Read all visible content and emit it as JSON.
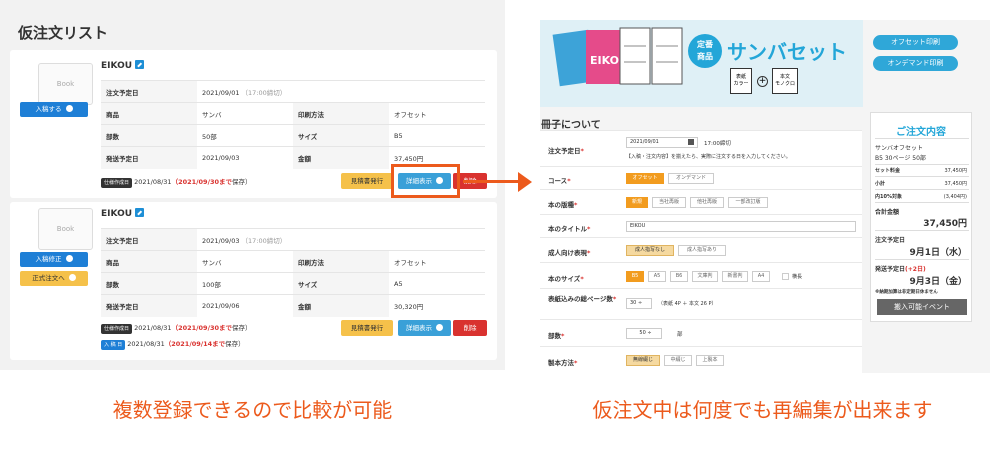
{
  "left": {
    "title": "仮注文リスト",
    "book_placeholder": "Book",
    "cards": [
      {
        "company": "EIKOU",
        "button1": "入稿する",
        "button2": "",
        "rows": [
          [
            "注文予定日",
            "2021/09/01",
            "（17:00締切）",
            "",
            ""
          ],
          [
            "商品",
            "サンバ",
            "",
            "印刷方法",
            "オフセット"
          ],
          [
            "部数",
            "50部",
            "",
            "サイズ",
            "B5"
          ],
          [
            "発送予定日",
            "2021/09/03",
            "",
            "金額",
            "37,450円"
          ]
        ],
        "status_badge": "仕様作成日",
        "status_date": "2021/08/31",
        "status_red": "（2021/09/30まで",
        "status_tail": "保存）",
        "status2_badge": "",
        "status2_date": "",
        "status2_red": "",
        "status2_tail": "",
        "btn_estimate": "見積書発行",
        "btn_detail": "詳細表示",
        "btn_delete": "削除"
      },
      {
        "company": "EIKOU",
        "button1": "入稿修正",
        "button2": "正式注文へ",
        "rows": [
          [
            "注文予定日",
            "2021/09/03",
            "（17:00締切）",
            "",
            ""
          ],
          [
            "商品",
            "サンバ",
            "",
            "印刷方法",
            "オフセット"
          ],
          [
            "部数",
            "100部",
            "",
            "サイズ",
            "A5"
          ],
          [
            "発送予定日",
            "2021/09/06",
            "",
            "金額",
            "30,320円"
          ]
        ],
        "status_badge": "仕様作成日",
        "status_date": "2021/08/31",
        "status_red": "（2021/09/30まで",
        "status_tail": "保存）",
        "status2_badge": "入 稿 日",
        "status2_date": "2021/08/31",
        "status2_red": "（2021/09/14まで",
        "status2_tail": "保存）",
        "btn_estimate": "見積書発行",
        "btn_detail": "詳細表示",
        "btn_delete": "削除"
      }
    ],
    "caption": "複数登録できるので比較が可能"
  },
  "right": {
    "banner_badge_line1": "定番",
    "banner_badge_line2": "商品",
    "banner_title": "サンバセット",
    "cover_label": "表紙\nカラー",
    "body_label": "本文\nモノクロ",
    "pill_offset": "オフセット印刷",
    "pill_ondemand": "オンデマンド印刷",
    "section_title": "冊子について",
    "form": {
      "order_date_label": "注文予定日",
      "order_date_value": "2021/09/01",
      "order_date_deadline": "17:00締切",
      "order_date_note": "【入稿・注文内容】を揃えたら、実際に注文する日を入力してください。",
      "course_label": "コース",
      "course_options": [
        "オフセット",
        "オンデマンド"
      ],
      "binding_label": "本の版種",
      "binding_options": [
        "新規",
        "当社再版",
        "他社再版",
        "一部改訂版"
      ],
      "title_label": "本のタイトル",
      "title_value": "EIKOU",
      "adult_label": "成人向け表現",
      "adult_options": [
        "成人指写なし",
        "成人指写あり"
      ],
      "size_label": "本のサイズ",
      "size_options": [
        "B5",
        "A5",
        "B6",
        "文庫判",
        "新書判",
        "A4"
      ],
      "size_checkbox": "横長",
      "pages_label": "表紙込みの総ページ数",
      "pages_value": "30",
      "pages_note": "（表紙 4P ＋ 本文 26 P）",
      "copies_label": "部数",
      "copies_value": "50",
      "copies_unit": "部",
      "method_label": "製本方法",
      "method_options": [
        "無線綴じ",
        "中綴じ",
        "上製本"
      ],
      "required_mark": "*"
    },
    "sidebar": {
      "title": "ご注文内容",
      "product": "サンバオフセット",
      "spec": "B5  30ページ  50部",
      "set_label": "セット料金",
      "set_value": "37,450円",
      "subtotal_label": "小計",
      "subtotal_value": "37,450円",
      "tax_label": "内10%対象",
      "tax_value": "(3,404円)",
      "total_label": "合計金額",
      "total_value": "37,450円",
      "order_date_label": "注文予定日",
      "order_date_value": "9月1日（水）",
      "ship_label": "発送予定日",
      "ship_extra": "(+2日)",
      "ship_value": "9月3日（金）",
      "note": "※納期加算は非定期日休ません",
      "cta": "搬入可能イベント"
    },
    "caption": "仮注文中は何度でも再編集が出来ます"
  },
  "colors": {
    "accent": "#ec5a1c",
    "blue": "#1e7fd6",
    "teal": "#23a6d8",
    "orange": "#f29c1f",
    "red": "#d9322f"
  }
}
